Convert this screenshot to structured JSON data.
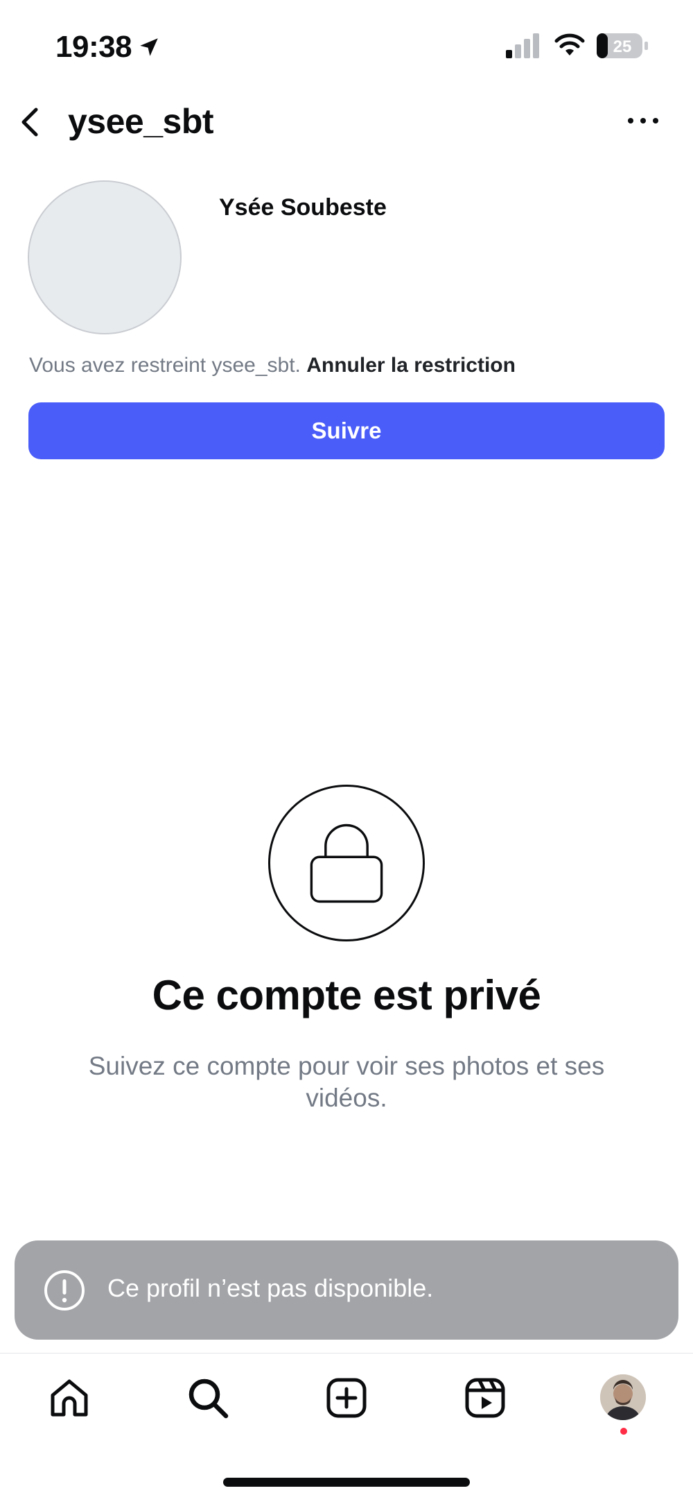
{
  "status_bar": {
    "time": "19:38",
    "battery_level": "25",
    "icons": [
      "location-arrow-icon",
      "cellular-signal-icon",
      "wifi-icon",
      "battery-icon"
    ]
  },
  "header": {
    "username": "ysee_sbt",
    "icons": [
      "back-chevron-icon",
      "more-options-icon"
    ]
  },
  "profile": {
    "display_name": "Ysée Soubeste",
    "restriction_text": "Vous avez restreint ysee_sbt.",
    "restriction_link": "Annuler la restriction",
    "follow_label": "Suivre"
  },
  "private_account": {
    "title": "Ce compte est privé",
    "subtitle": "Suivez ce compte pour voir ses photos et ses vidéos.",
    "icon": "lock-icon"
  },
  "toast": {
    "message": "Ce profil n’est pas disponible.",
    "icon": "exclamation-circle-icon"
  },
  "tab_bar": {
    "items": [
      "home-icon",
      "search-icon",
      "create-icon",
      "reels-icon",
      "profile-avatar"
    ],
    "has_notification_dot": true
  },
  "colors": {
    "accent": "#4a5df8",
    "text_primary": "#0b0c0e",
    "text_secondary": "#737a85",
    "toast_background": "#a3a4a8",
    "notification_dot": "#ff2d46"
  }
}
